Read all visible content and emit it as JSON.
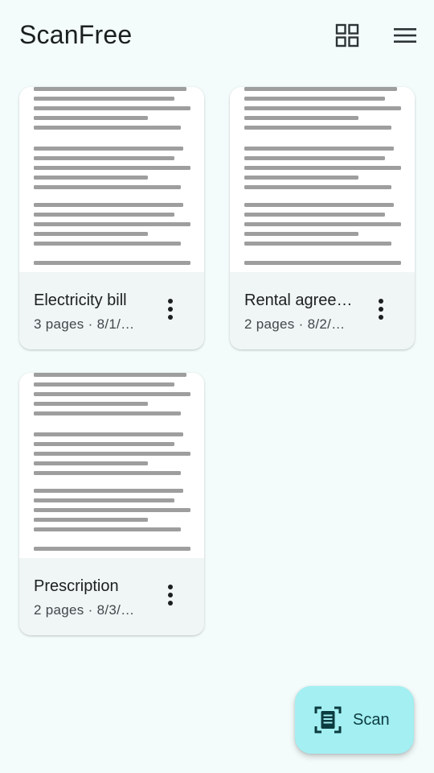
{
  "app": {
    "title": "ScanFree"
  },
  "toolbar": {
    "grid_icon": "grid-view-icon",
    "menu_icon": "menu-icon"
  },
  "documents": [
    {
      "name": "Electricity bill",
      "meta": "3 pages · 8/1/…"
    },
    {
      "name": "Rental agreement",
      "meta": "2 pages · 8/2/…"
    },
    {
      "name": "Prescription",
      "meta": "2 pages · 8/3/…"
    }
  ],
  "fab": {
    "label": "Scan",
    "icon": "document-scanner-icon"
  },
  "colors": {
    "background": "#f3fbfb",
    "card": "#f0f5f5",
    "fab": "#a3eff2",
    "text_line": "#9e9e9e"
  }
}
